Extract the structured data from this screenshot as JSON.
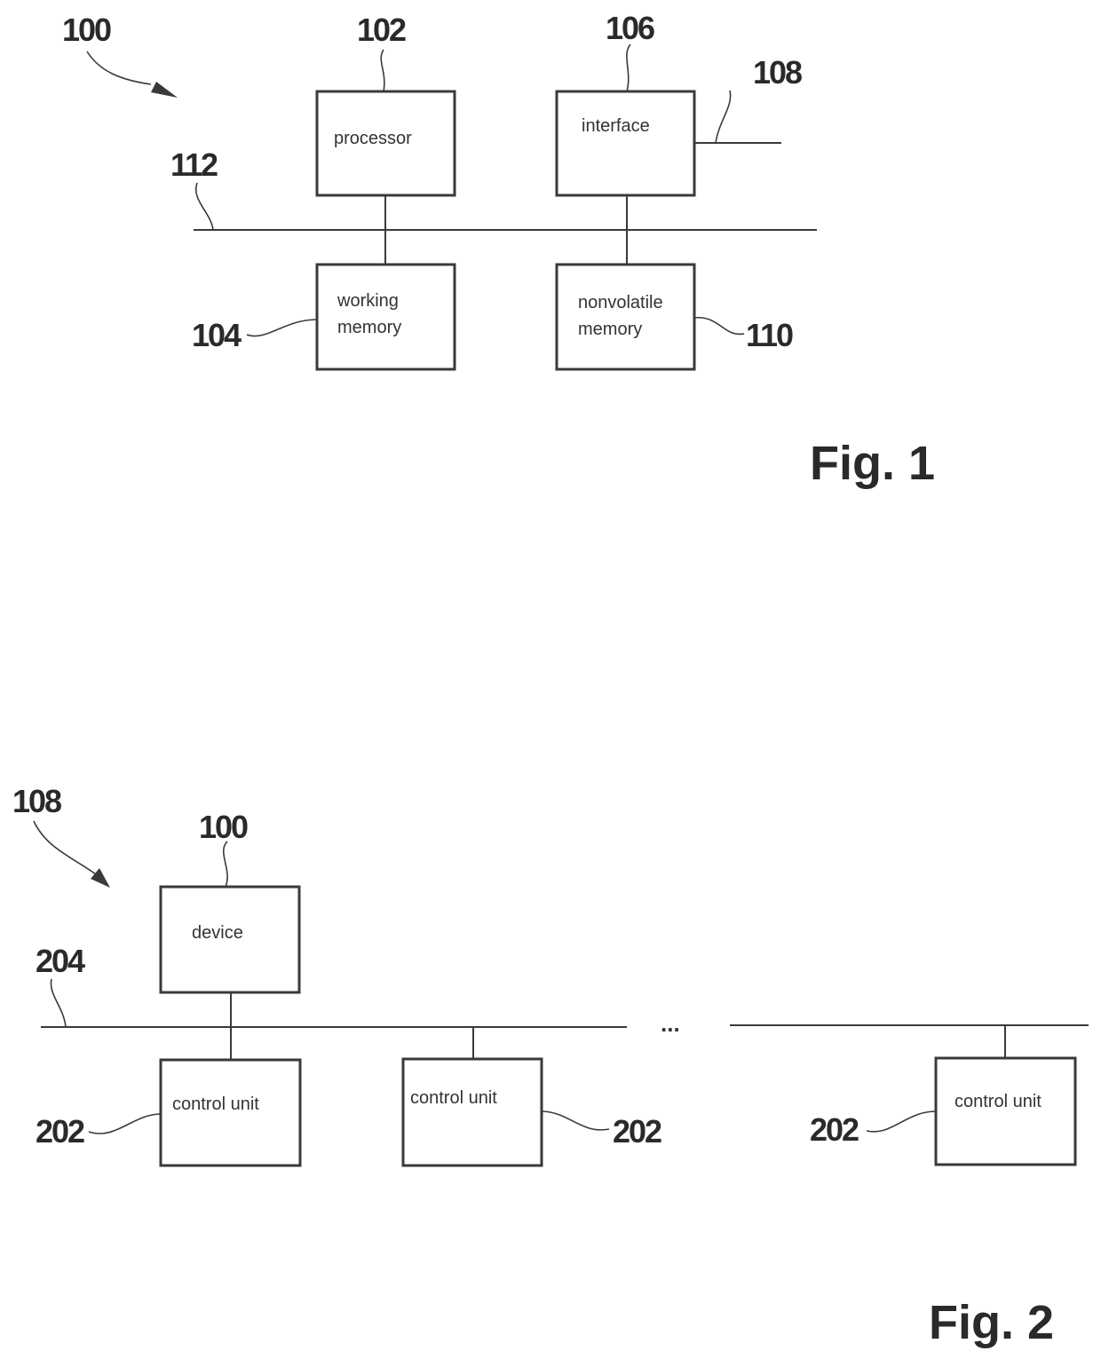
{
  "fig1": {
    "label": "Fig. 1",
    "ref_device": "100",
    "ref_bus": "112",
    "ref_external": "108",
    "blocks": {
      "processor": {
        "ref": "102",
        "lines": [
          "processor"
        ]
      },
      "interface": {
        "ref": "106",
        "lines": [
          "interface"
        ]
      },
      "working_memory": {
        "ref": "104",
        "lines": [
          "working",
          "memory"
        ]
      },
      "nonvolatile_memory": {
        "ref": "110",
        "lines": [
          "nonvolatile",
          "memory"
        ]
      }
    }
  },
  "fig2": {
    "label": "Fig. 2",
    "ref_system": "108",
    "ref_bus": "204",
    "ellipsis": "...",
    "device": {
      "ref": "100",
      "lines": [
        "device"
      ]
    },
    "control_units": [
      {
        "ref": "202",
        "lines": [
          "control unit"
        ]
      },
      {
        "ref": "202",
        "lines": [
          "control unit"
        ]
      },
      {
        "ref": "202",
        "lines": [
          "control unit"
        ]
      }
    ]
  }
}
